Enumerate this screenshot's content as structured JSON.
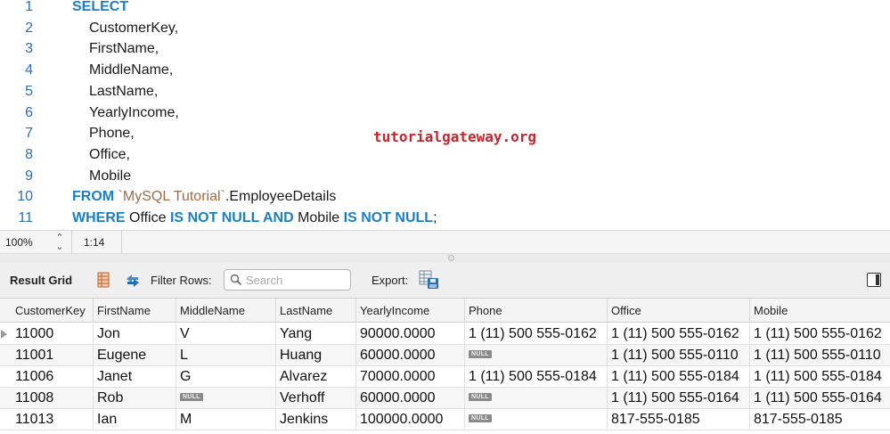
{
  "editor": {
    "lines": [
      {
        "num": "1",
        "parts": [
          {
            "t": "SELECT",
            "k": "kw"
          }
        ]
      },
      {
        "num": "2",
        "indent": true,
        "parts": [
          {
            "t": "CustomerKey,",
            "k": "plain"
          }
        ]
      },
      {
        "num": "3",
        "indent": true,
        "parts": [
          {
            "t": "FirstName,",
            "k": "plain"
          }
        ]
      },
      {
        "num": "4",
        "indent": true,
        "parts": [
          {
            "t": "MiddleName,",
            "k": "plain"
          }
        ]
      },
      {
        "num": "5",
        "indent": true,
        "parts": [
          {
            "t": "LastName,",
            "k": "plain"
          }
        ]
      },
      {
        "num": "6",
        "indent": true,
        "parts": [
          {
            "t": "YearlyIncome,",
            "k": "plain"
          }
        ]
      },
      {
        "num": "7",
        "indent": true,
        "parts": [
          {
            "t": "Phone,",
            "k": "plain"
          }
        ]
      },
      {
        "num": "8",
        "indent": true,
        "parts": [
          {
            "t": "Office,",
            "k": "plain"
          }
        ]
      },
      {
        "num": "9",
        "indent": true,
        "parts": [
          {
            "t": "Mobile",
            "k": "plain"
          }
        ]
      },
      {
        "num": "10",
        "parts": [
          {
            "t": "FROM ",
            "k": "kw"
          },
          {
            "t": "`MySQL Tutorial`",
            "k": "str"
          },
          {
            "t": ".EmployeeDetails",
            "k": "plain"
          }
        ]
      },
      {
        "num": "11",
        "parts": [
          {
            "t": "WHERE ",
            "k": "kw"
          },
          {
            "t": "Office ",
            "k": "plain"
          },
          {
            "t": "IS NOT NULL AND ",
            "k": "kw"
          },
          {
            "t": "Mobile ",
            "k": "plain"
          },
          {
            "t": "IS NOT NULL",
            "k": "kw"
          },
          {
            "t": ";",
            "k": "plain"
          }
        ]
      }
    ],
    "watermark": "tutorialgateway.org"
  },
  "status": {
    "zoom": "100%",
    "cursor": "1:14"
  },
  "toolbar": {
    "result_grid_label": "Result Grid",
    "filter_label": "Filter Rows:",
    "search_placeholder": "Search",
    "search_value": "",
    "export_label": "Export:"
  },
  "grid": {
    "null_label": "NULL",
    "columns": [
      "CustomerKey",
      "FirstName",
      "MiddleName",
      "LastName",
      "YearlyIncome",
      "Phone",
      "Office",
      "Mobile"
    ],
    "rows": [
      [
        "11000",
        "Jon",
        "V",
        "Yang",
        "90000.0000",
        "1 (11) 500 555-0162",
        "1 (11) 500 555-0162",
        "1 (11) 500 555-0162"
      ],
      [
        "11001",
        "Eugene",
        "L",
        "Huang",
        "60000.0000",
        null,
        "1 (11) 500 555-0110",
        "1 (11) 500 555-0110"
      ],
      [
        "11006",
        "Janet",
        "G",
        "Alvarez",
        "70000.0000",
        "1 (11) 500 555-0184",
        "1 (11) 500 555-0184",
        "1 (11) 500 555-0184"
      ],
      [
        "11008",
        "Rob",
        null,
        "Verhoff",
        "60000.0000",
        null,
        "1 (11) 500 555-0164",
        "1 (11) 500 555-0164"
      ],
      [
        "11013",
        "Ian",
        "M",
        "Jenkins",
        "100000.0000",
        null,
        "817-555-0185",
        "817-555-0185"
      ]
    ],
    "selected_row": 0
  }
}
